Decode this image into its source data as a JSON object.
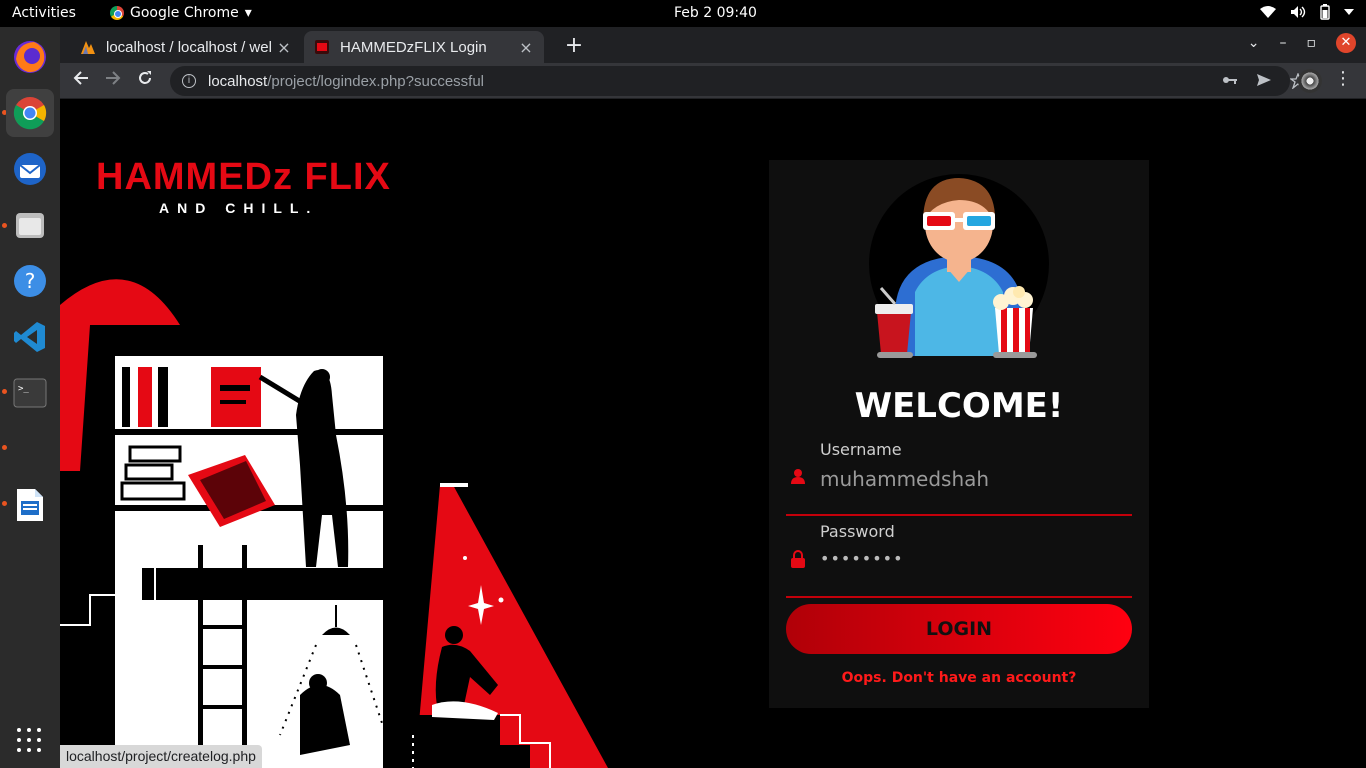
{
  "topbar": {
    "activities": "Activities",
    "app_name": "Google Chrome",
    "clock": "Feb 2  09:40"
  },
  "dock": {
    "items": [
      "firefox",
      "chrome",
      "thunderbird",
      "files",
      "help",
      "vscode",
      "terminal",
      "libreoffice-writer"
    ]
  },
  "browser": {
    "tabs": [
      {
        "title": "localhost / localhost / wel",
        "close": "×"
      },
      {
        "title": "HAMMEDzFLIX Login",
        "close": "×"
      }
    ],
    "new_tab": "+",
    "url_host": "localhost",
    "url_path": "/project/logindex.php?successful",
    "status_url": "localhost/project/createlog.php"
  },
  "page": {
    "logo_title": "HAMMEDz FLIX",
    "logo_tagline": "AND CHILL.",
    "welcome": "WELCOME!",
    "username_label": "Username",
    "username_value": "muhammedshah",
    "password_label": "Password",
    "password_value": "••••••••",
    "login_button": "LOGIN",
    "signup_link": "Oops. Don't have an account?"
  },
  "colors": {
    "brand_red": "#e50914",
    "page_bg": "#000000",
    "card_bg": "#0f0f0f"
  }
}
